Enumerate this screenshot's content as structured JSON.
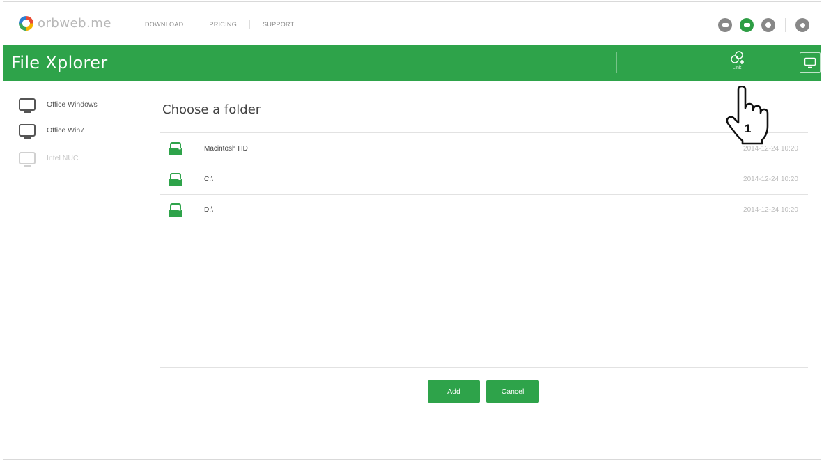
{
  "brand": {
    "logo_text": "orbweb.me"
  },
  "topnav": {
    "links": [
      "DOWNLOAD",
      "PRICING",
      "SUPPORT"
    ],
    "icons": [
      "chat-icon",
      "folder-icon",
      "settings-icon",
      "user-icon"
    ],
    "active_icon": "folder-icon"
  },
  "header": {
    "title": "File Xplorer",
    "link_label": "Link",
    "accent_color": "#2ea34a"
  },
  "sidebar": {
    "devices": [
      {
        "label": "Office Windows",
        "enabled": true
      },
      {
        "label": "Office Win7",
        "enabled": true
      },
      {
        "label": "Intel NUC",
        "enabled": false
      }
    ]
  },
  "main": {
    "title": "Choose a folder",
    "folders": [
      {
        "name": "Macintosh HD",
        "date": "2014-12-24 10:20"
      },
      {
        "name": "C:\\",
        "date": "2014-12-24 10:20"
      },
      {
        "name": "D:\\",
        "date": "2014-12-24 10:20"
      }
    ],
    "add_label": "Add",
    "cancel_label": "Cancel"
  },
  "annotation": {
    "step_number": "1"
  }
}
